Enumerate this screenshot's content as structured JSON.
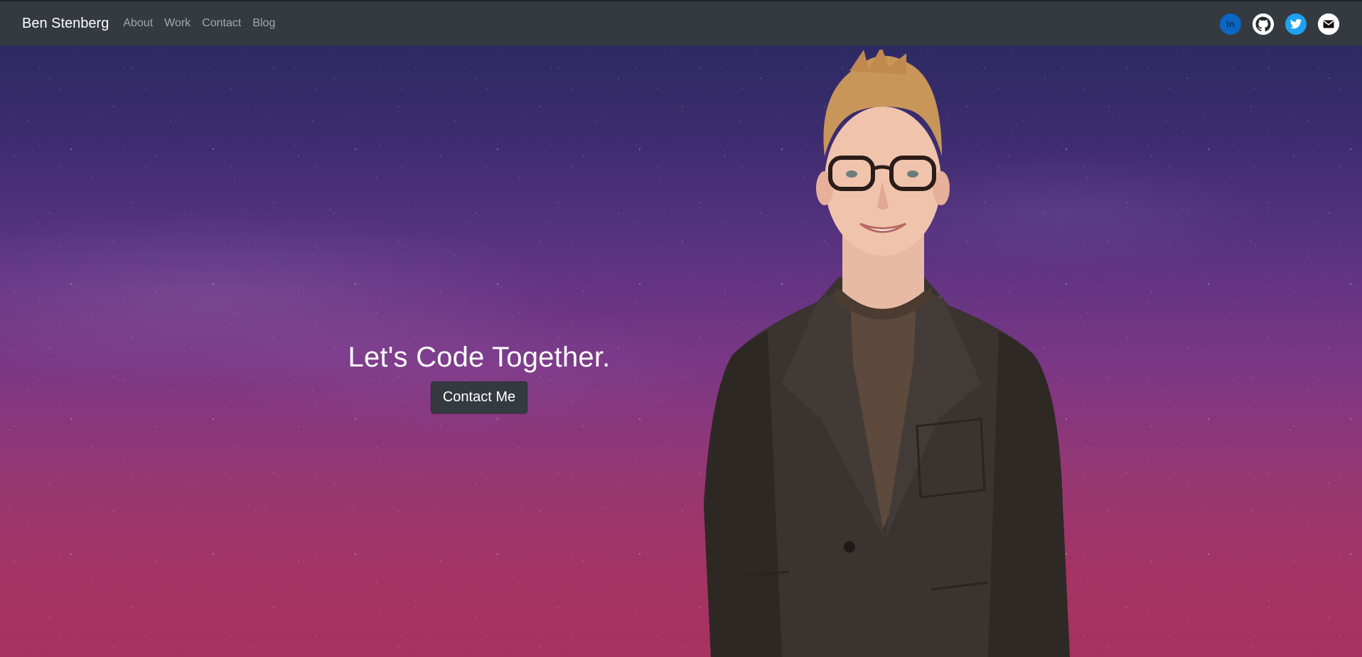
{
  "nav": {
    "brand": "Ben Stenberg",
    "links": [
      {
        "label": "About"
      },
      {
        "label": "Work"
      },
      {
        "label": "Contact"
      },
      {
        "label": "Blog"
      }
    ],
    "social": [
      {
        "name": "linkedin",
        "icon": "linkedin-icon",
        "color": "#0a66c2",
        "glyph": "in"
      },
      {
        "name": "github",
        "icon": "github-icon",
        "color": "#ffffff"
      },
      {
        "name": "twitter",
        "icon": "twitter-icon",
        "color": "#1da1f2"
      },
      {
        "name": "email",
        "icon": "mail-icon",
        "color": "#ffffff"
      }
    ]
  },
  "hero": {
    "title": "Let's Code Together.",
    "cta_label": "Contact Me"
  },
  "colors": {
    "navbar": "#343a40",
    "background_top": "#27295e",
    "background_bottom": "#a8325f",
    "button": "#343a40"
  }
}
